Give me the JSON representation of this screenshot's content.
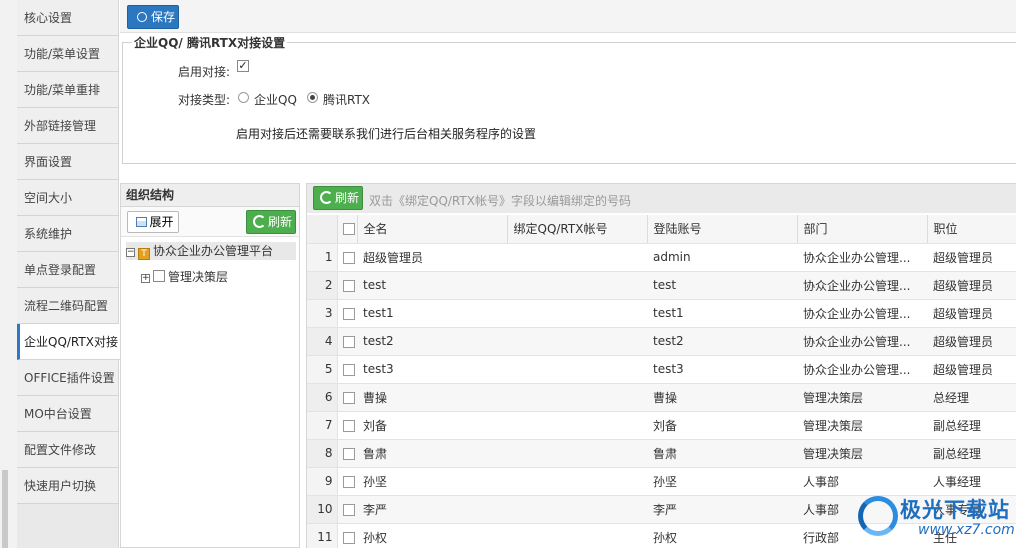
{
  "sidebar": {
    "items": [
      {
        "label": "核心设置"
      },
      {
        "label": "功能/菜单设置"
      },
      {
        "label": "功能/菜单重排"
      },
      {
        "label": "外部链接管理"
      },
      {
        "label": "界面设置"
      },
      {
        "label": "空间大小"
      },
      {
        "label": "系统维护"
      },
      {
        "label": "单点登录配置"
      },
      {
        "label": "流程二维码配置"
      },
      {
        "label": "企业QQ/RTX对接"
      },
      {
        "label": "OFFICE插件设置"
      },
      {
        "label": "MO中台设置"
      },
      {
        "label": "配置文件修改"
      },
      {
        "label": "快速用户切换"
      }
    ],
    "active_index": 9
  },
  "toolbar": {
    "save_label": "保存"
  },
  "settings": {
    "legend": "企业QQ/ 腾讯RTX对接设置",
    "enable_label": "启用对接:",
    "enable_checked": true,
    "type_label": "对接类型:",
    "type_options": [
      "企业QQ",
      "腾讯RTX"
    ],
    "type_selected": "腾讯RTX",
    "hint": "启用对接后还需要联系我们进行后台相关服务程序的设置"
  },
  "tree": {
    "title": "组织结构",
    "expand_label": "展开",
    "refresh_label": "刷新",
    "root": {
      "label": "协众企业办公管理平台",
      "toggle": "−",
      "icon": "org-icon"
    },
    "child": {
      "label": "管理决策层",
      "toggle": "+",
      "icon": "dept-icon"
    }
  },
  "grid": {
    "refresh_label": "刷新",
    "hint": "双击《绑定QQ/RTX帐号》字段以编辑绑定的号码",
    "columns": [
      "全名",
      "绑定QQ/RTX帐号",
      "登陆账号",
      "部门",
      "职位"
    ],
    "rows": [
      {
        "num": "1",
        "name": "超级管理员",
        "bind": "",
        "login": "admin",
        "dept": "协众企业办公管理...",
        "title": "超级管理员"
      },
      {
        "num": "2",
        "name": "test",
        "bind": "",
        "login": "test",
        "dept": "协众企业办公管理...",
        "title": "超级管理员"
      },
      {
        "num": "3",
        "name": "test1",
        "bind": "",
        "login": "test1",
        "dept": "协众企业办公管理...",
        "title": "超级管理员"
      },
      {
        "num": "4",
        "name": "test2",
        "bind": "",
        "login": "test2",
        "dept": "协众企业办公管理...",
        "title": "超级管理员"
      },
      {
        "num": "5",
        "name": "test3",
        "bind": "",
        "login": "test3",
        "dept": "协众企业办公管理...",
        "title": "超级管理员"
      },
      {
        "num": "6",
        "name": "曹操",
        "bind": "",
        "login": "曹操",
        "dept": "管理决策层",
        "title": "总经理"
      },
      {
        "num": "7",
        "name": "刘备",
        "bind": "",
        "login": "刘备",
        "dept": "管理决策层",
        "title": "副总经理"
      },
      {
        "num": "8",
        "name": "鲁肃",
        "bind": "",
        "login": "鲁肃",
        "dept": "管理决策层",
        "title": "副总经理"
      },
      {
        "num": "9",
        "name": "孙坚",
        "bind": "",
        "login": "孙坚",
        "dept": "人事部",
        "title": "人事经理"
      },
      {
        "num": "10",
        "name": "李严",
        "bind": "",
        "login": "李严",
        "dept": "人事部",
        "title": "人事专员"
      },
      {
        "num": "11",
        "name": "孙权",
        "bind": "",
        "login": "孙权",
        "dept": "行政部",
        "title": "主任"
      }
    ]
  },
  "watermark": {
    "name": "极光下载站",
    "url": "www.xz7.com"
  },
  "colors": {
    "primary": "#2b77c0",
    "success": "#4cae4c",
    "accent_border": "#2f78c4"
  }
}
